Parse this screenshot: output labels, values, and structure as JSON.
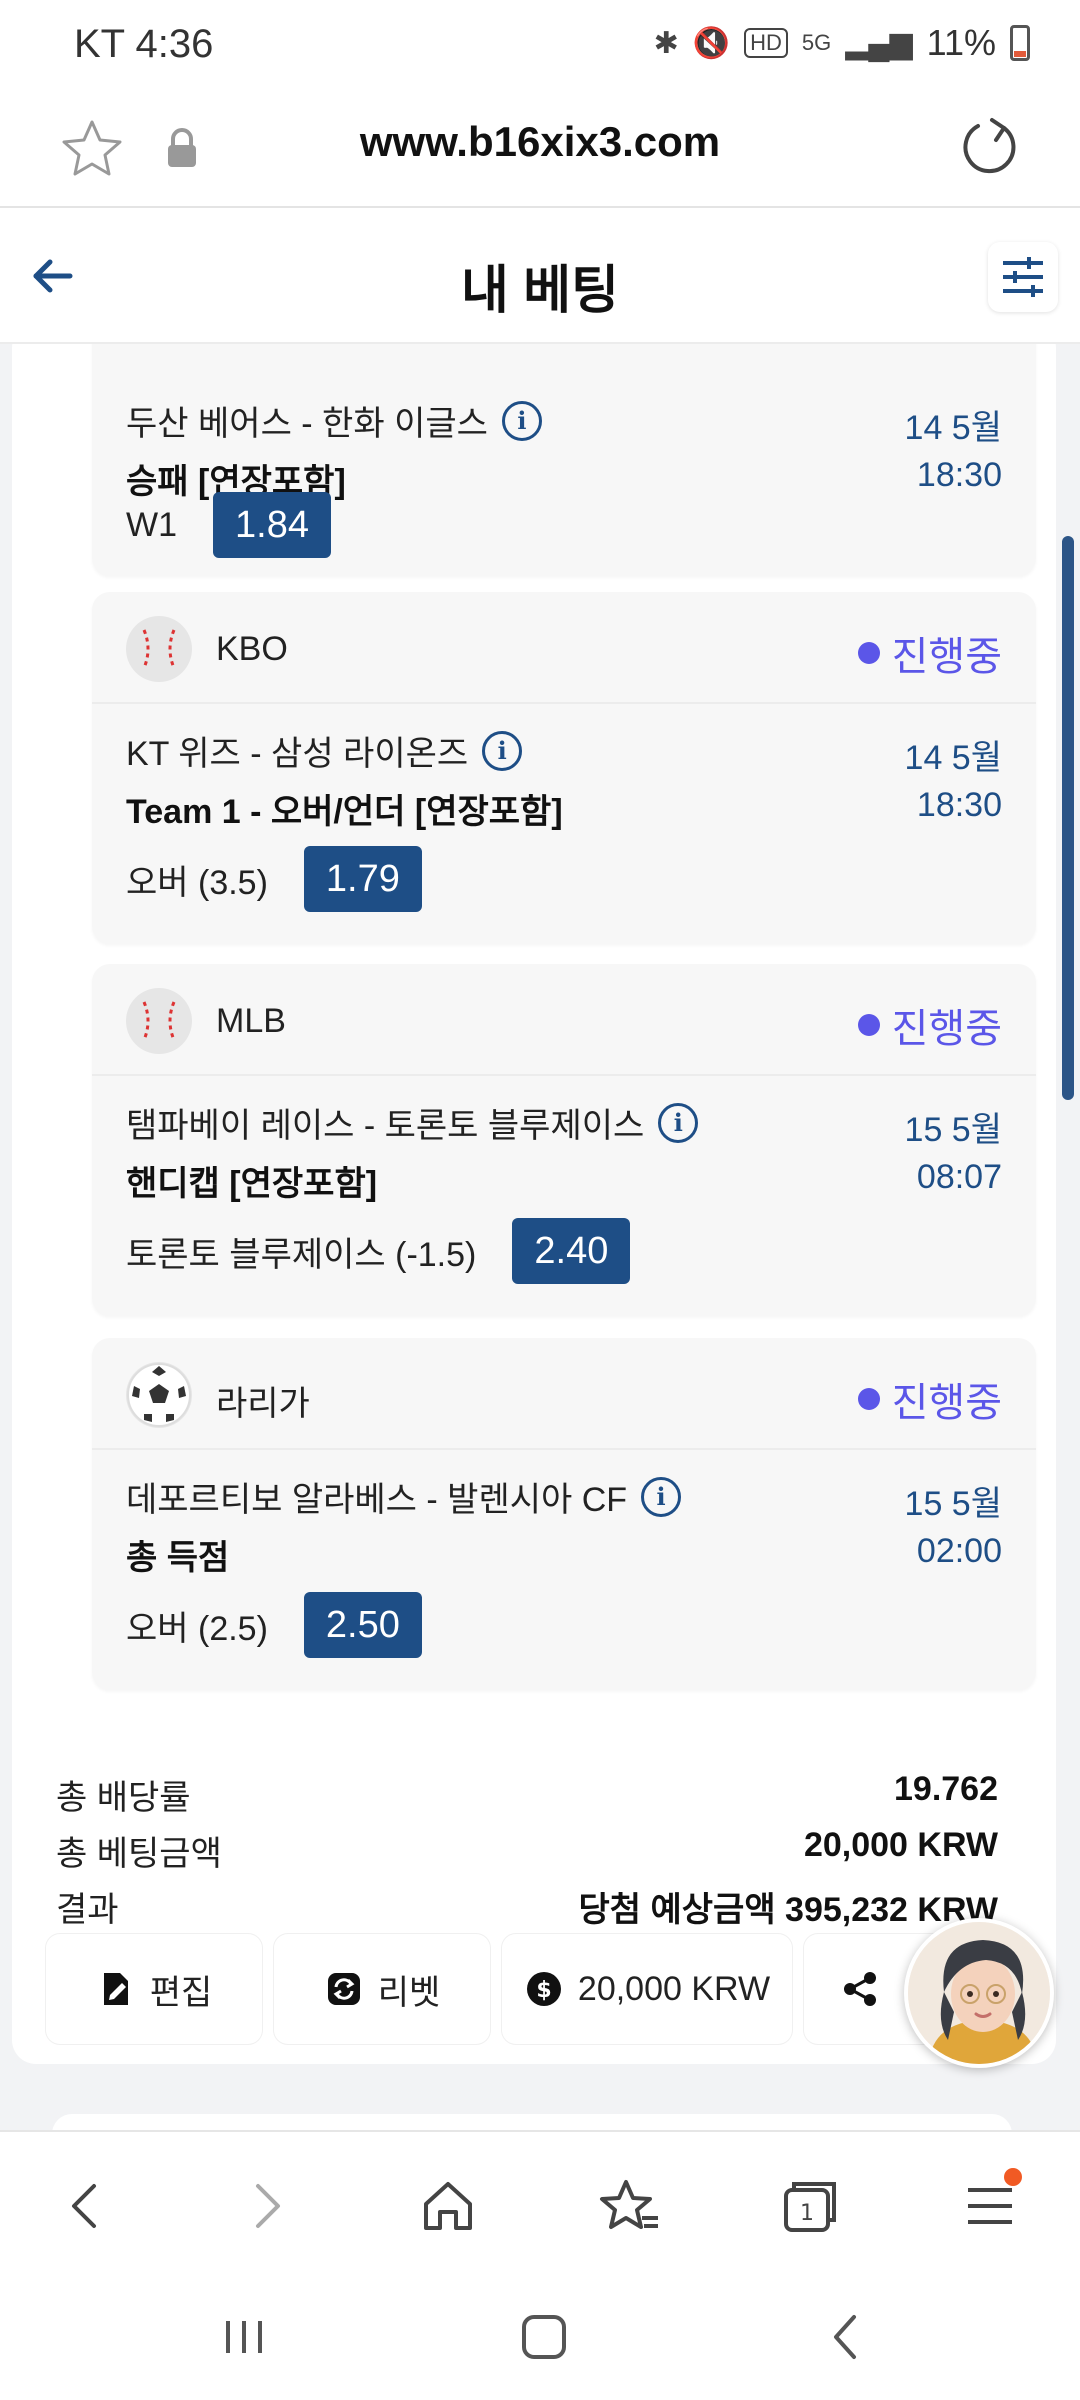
{
  "status": {
    "time": "KT 4:36",
    "battery": "11%",
    "icons": [
      "bluetooth-icon",
      "mute-icon",
      "hd-icon",
      "5g-icon",
      "signal-icon",
      "battery-icon"
    ]
  },
  "browser": {
    "url": "www.b16xix3.com"
  },
  "header": {
    "title": "내 베팅"
  },
  "bets": [
    {
      "league": "",
      "status": "",
      "match": "두산 베어스 - 한화 이글스",
      "market": "승패 [연장포함]",
      "date": "14 5월",
      "time": "18:30",
      "pick": "W1",
      "odds": "1.84"
    },
    {
      "league": "KBO",
      "sport_icon": "baseball-icon",
      "status": "진행중",
      "match": "KT 위즈 - 삼성 라이온즈",
      "market": "Team 1 - 오버/언더 [연장포함]",
      "date": "14 5월",
      "time": "18:30",
      "pick": "오버 (3.5)",
      "odds": "1.79"
    },
    {
      "league": "MLB",
      "sport_icon": "baseball-icon",
      "status": "진행중",
      "match": "탬파베이 레이스 - 토론토 블루제이스",
      "market": "핸디캡 [연장포함]",
      "date": "15 5월",
      "time": "08:07",
      "pick": "토론토 블루제이스 (-1.5)",
      "odds": "2.40"
    },
    {
      "league": "라리가",
      "sport_icon": "soccer-ball-icon",
      "status": "진행중",
      "match": "데포르티보 알라베스 - 발렌시아 CF",
      "market": "총 득점",
      "date": "15 5월",
      "time": "02:00",
      "pick": "오버 (2.5)",
      "odds": "2.50"
    }
  ],
  "summary": {
    "total_odds_label": "총 배당률",
    "total_odds_value": "19.762",
    "total_stake_label": "총 베팅금액",
    "total_stake_value": "20,000 KRW",
    "result_label": "결과",
    "result_value": "당첨 예상금액 395,232 KRW"
  },
  "actions": {
    "edit": "편집",
    "rebet": "리벳",
    "cashout": "20,000 KRW"
  },
  "colors": {
    "accent": "#1e4e86",
    "live": "#5b56e8",
    "notification": "#f15a24"
  }
}
